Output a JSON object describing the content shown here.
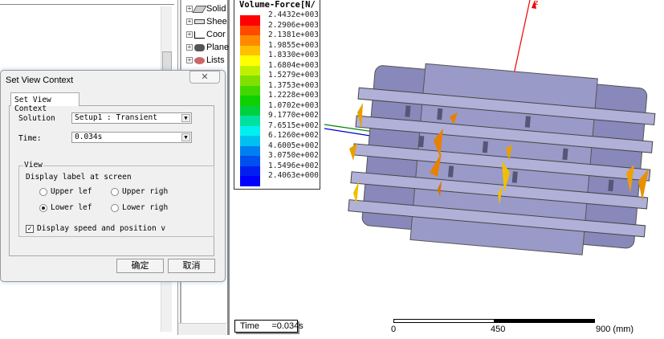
{
  "tree": {
    "items": [
      {
        "label": "Solid",
        "icon": "solid-icon"
      },
      {
        "label": "Shee",
        "icon": "sheet-icon"
      },
      {
        "label": "Coor",
        "icon": "coordinate-system-icon"
      },
      {
        "label": "Plane",
        "icon": "plane-icon"
      },
      {
        "label": "Lists",
        "icon": "lists-icon"
      }
    ]
  },
  "legend": {
    "title": "Volume-Force[N/",
    "values": [
      "2.4432e+003",
      "2.2906e+003",
      "2.1381e+003",
      "1.9855e+003",
      "1.8330e+003",
      "1.6804e+003",
      "1.5279e+003",
      "1.3753e+003",
      "1.2228e+003",
      "1.0702e+003",
      "9.1770e+002",
      "7.6515e+002",
      "6.1260e+002",
      "4.6005e+002",
      "3.0750e+002",
      "1.5496e+002",
      "2.4063e+000"
    ],
    "colors": [
      "#ff0000",
      "#ff4a00",
      "#ff8a00",
      "#ffc000",
      "#ffff00",
      "#c0f000",
      "#80e000",
      "#40d800",
      "#10d000",
      "#00d040",
      "#00e0a0",
      "#00f0f0",
      "#00c0f0",
      "#0080f0",
      "#0050f0",
      "#0020f0",
      "#0000ff"
    ]
  },
  "dialog": {
    "title": "Set View Context",
    "close": "✕",
    "tab": "Set View Context",
    "solution_label": "Solution",
    "solution_value": "Setup1 : Transient",
    "time_label": "Time:",
    "time_value": "0.034s",
    "group_title": "View",
    "display_label": "Display label at screen",
    "radios": [
      "Upper lef",
      "Upper righ",
      "Lower lef",
      "Lower righ"
    ],
    "checkbox_label": "Display speed and position v",
    "ok": "确定",
    "cancel": "取消"
  },
  "viewport": {
    "time_label": "Time     =0.034s",
    "scale": [
      "0",
      "450",
      "900 (mm)"
    ],
    "axis_z": "z"
  }
}
